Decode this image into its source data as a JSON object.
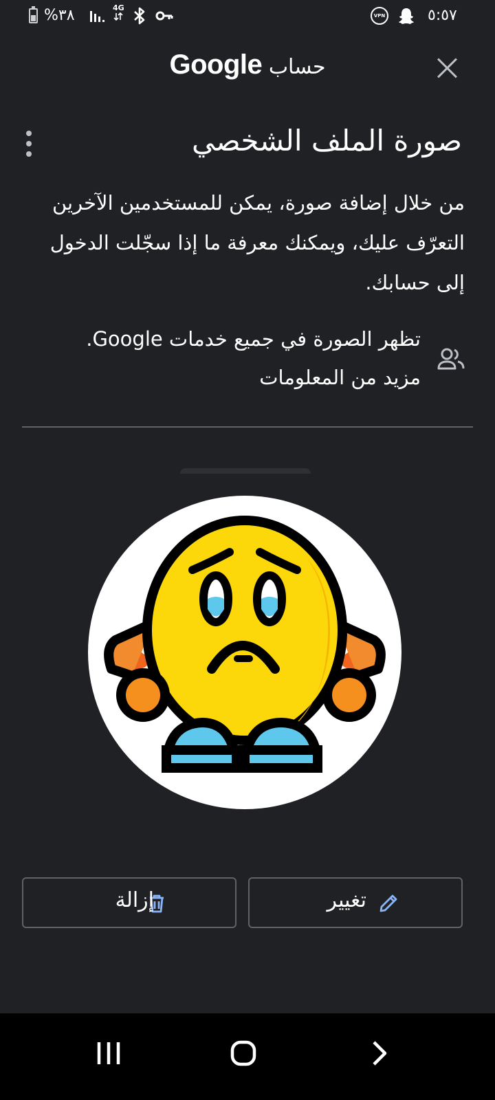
{
  "status_bar": {
    "battery_text": "%٣٨",
    "network_label": "4G",
    "vpn_label": "VPN",
    "time": "٥:٥٧"
  },
  "app_bar": {
    "title_prefix": "حساب",
    "title_brand": "Google",
    "close_icon": "close-icon"
  },
  "page": {
    "title": "صورة الملف الشخصي",
    "description": "من خلال إضافة صورة، يمكن للمستخدمين الآخرين التعرّف عليك، ويمكنك معرفة ما إذا سجّلت الدخول إلى حسابك.",
    "info_text": "تظهر الصورة في جميع خدمات Google.",
    "info_link": "مزيد من المعلومات",
    "info_icon": "people-icon"
  },
  "avatar": {
    "icon": "sad-emoji-avatar"
  },
  "actions": {
    "change_label": "تغيير",
    "change_icon": "pencil-icon",
    "remove_label": "إزالة",
    "remove_icon": "trash-icon"
  },
  "colors": {
    "background": "#202124",
    "accent": "#8ab4f8",
    "emoji_face": "#fcd80a",
    "emoji_hands": "#f5901e",
    "emoji_feet": "#5ec8ec"
  }
}
